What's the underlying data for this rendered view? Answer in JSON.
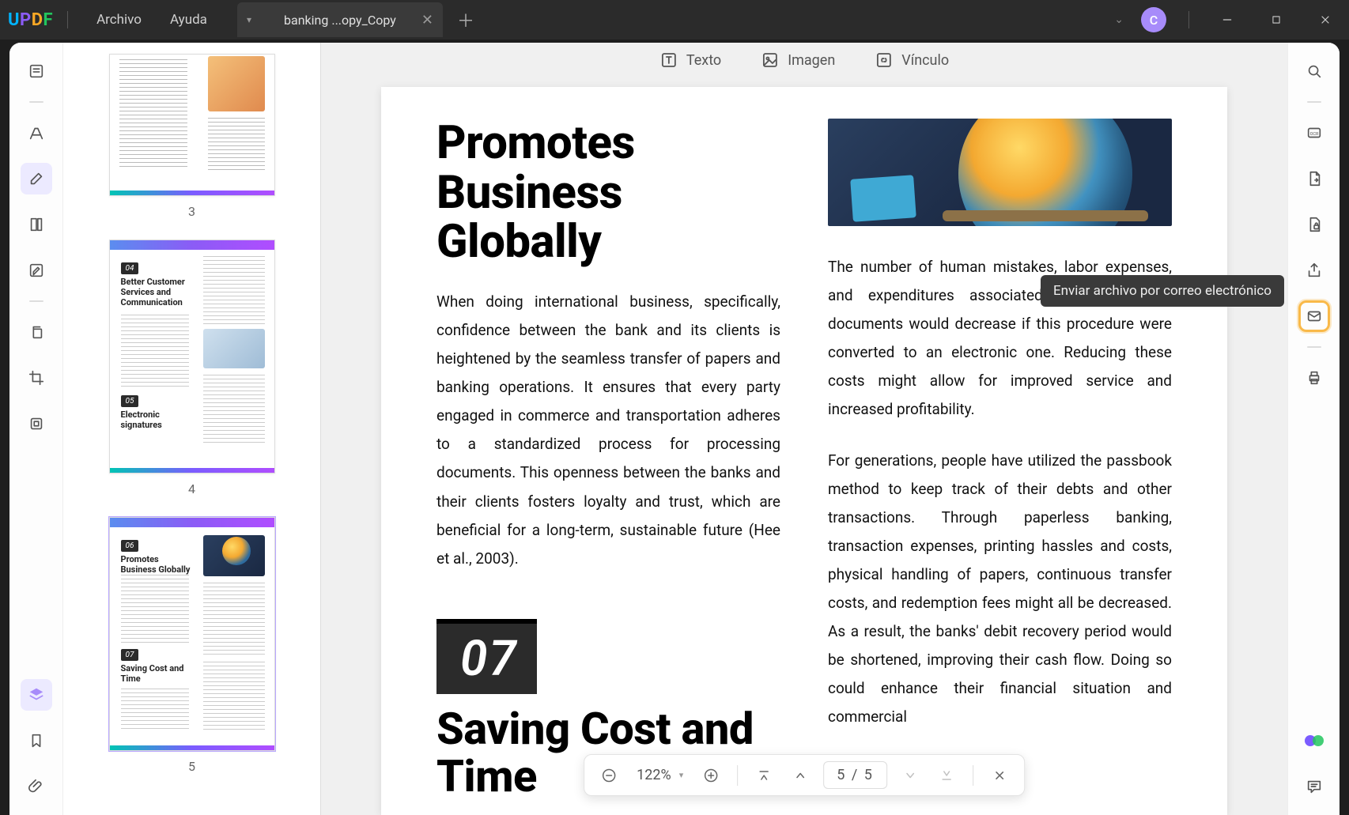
{
  "menu": {
    "archivo": "Archivo",
    "ayuda": "Ayuda"
  },
  "tab": {
    "title": "banking ...opy_Copy"
  },
  "avatar_initial": "C",
  "top_tools": {
    "texto": "Texto",
    "imagen": "Imagen",
    "vinculo": "Vínculo"
  },
  "thumbnails": {
    "p3": {
      "num": "3"
    },
    "p4": {
      "num": "4",
      "tag_a": "04",
      "head_a": "Better Customer Services and Communication",
      "tag_b": "05",
      "head_b": "Electronic signatures"
    },
    "p5": {
      "num": "5",
      "tag_a": "06",
      "head_a": "Promotes Business Globally",
      "tag_b": "07",
      "head_b": "Saving Cost and Time"
    }
  },
  "doc": {
    "title_a": "Promotes Business Globally",
    "para_a": "When doing international business, specifically, confidence between the bank and its clients is heightened by the seamless transfer of papers and banking operations. It ensures that every party engaged in commerce and transportation adheres to a standardized process for processing documents. This openness between the banks and their clients fosters loyalty and trust, which are beneficial for a long-term, sustainable future (Hee et al., 2003).",
    "num_box": "07",
    "title_b": "Saving Cost and Time",
    "para_r1": "The number of human mistakes, labor expenses, and expenditures associated with the store documents would decrease if this procedure were converted to an electronic one. Reducing these costs might allow for improved service and increased profitability.",
    "para_r2": "For generations, people have utilized the passbook method to keep track of their debts and other transactions. Through paperless banking, transaction expenses, printing hassles and costs, physical handling of papers, continuous transfer costs, and redemption fees might all be decreased. As a result, the banks' debit recovery period would be shortened, improving their cash flow. Doing so could enhance their financial situation and commercial"
  },
  "tooltip": "Enviar archivo por correo electrónico",
  "bottom": {
    "zoom": "122%",
    "page": "5  /  5"
  }
}
